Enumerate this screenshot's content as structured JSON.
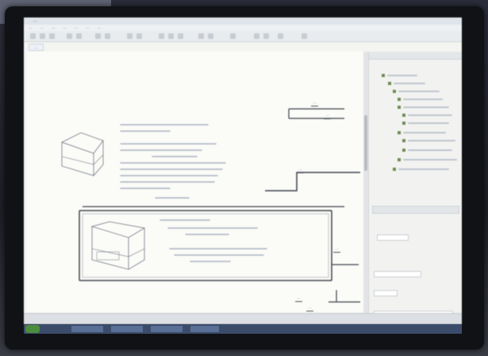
{
  "window": {
    "title": "..."
  },
  "tab": {
    "label": "..."
  },
  "menu": [
    "...",
    "...",
    "...",
    "...",
    "...",
    "...",
    "..."
  ],
  "mindmap": {
    "nodes": [
      "...",
      "...",
      "...",
      "...",
      "...",
      "..."
    ]
  },
  "colors": {
    "accent": "#5a6a9a",
    "canvas": "#fbfbf7",
    "panel": "#f2f3f1",
    "taskbar": "#3b4c6b",
    "start": "#4c8c3e"
  },
  "icons": [
    "prism-diagram-icon",
    "folder-tree-icon"
  ]
}
